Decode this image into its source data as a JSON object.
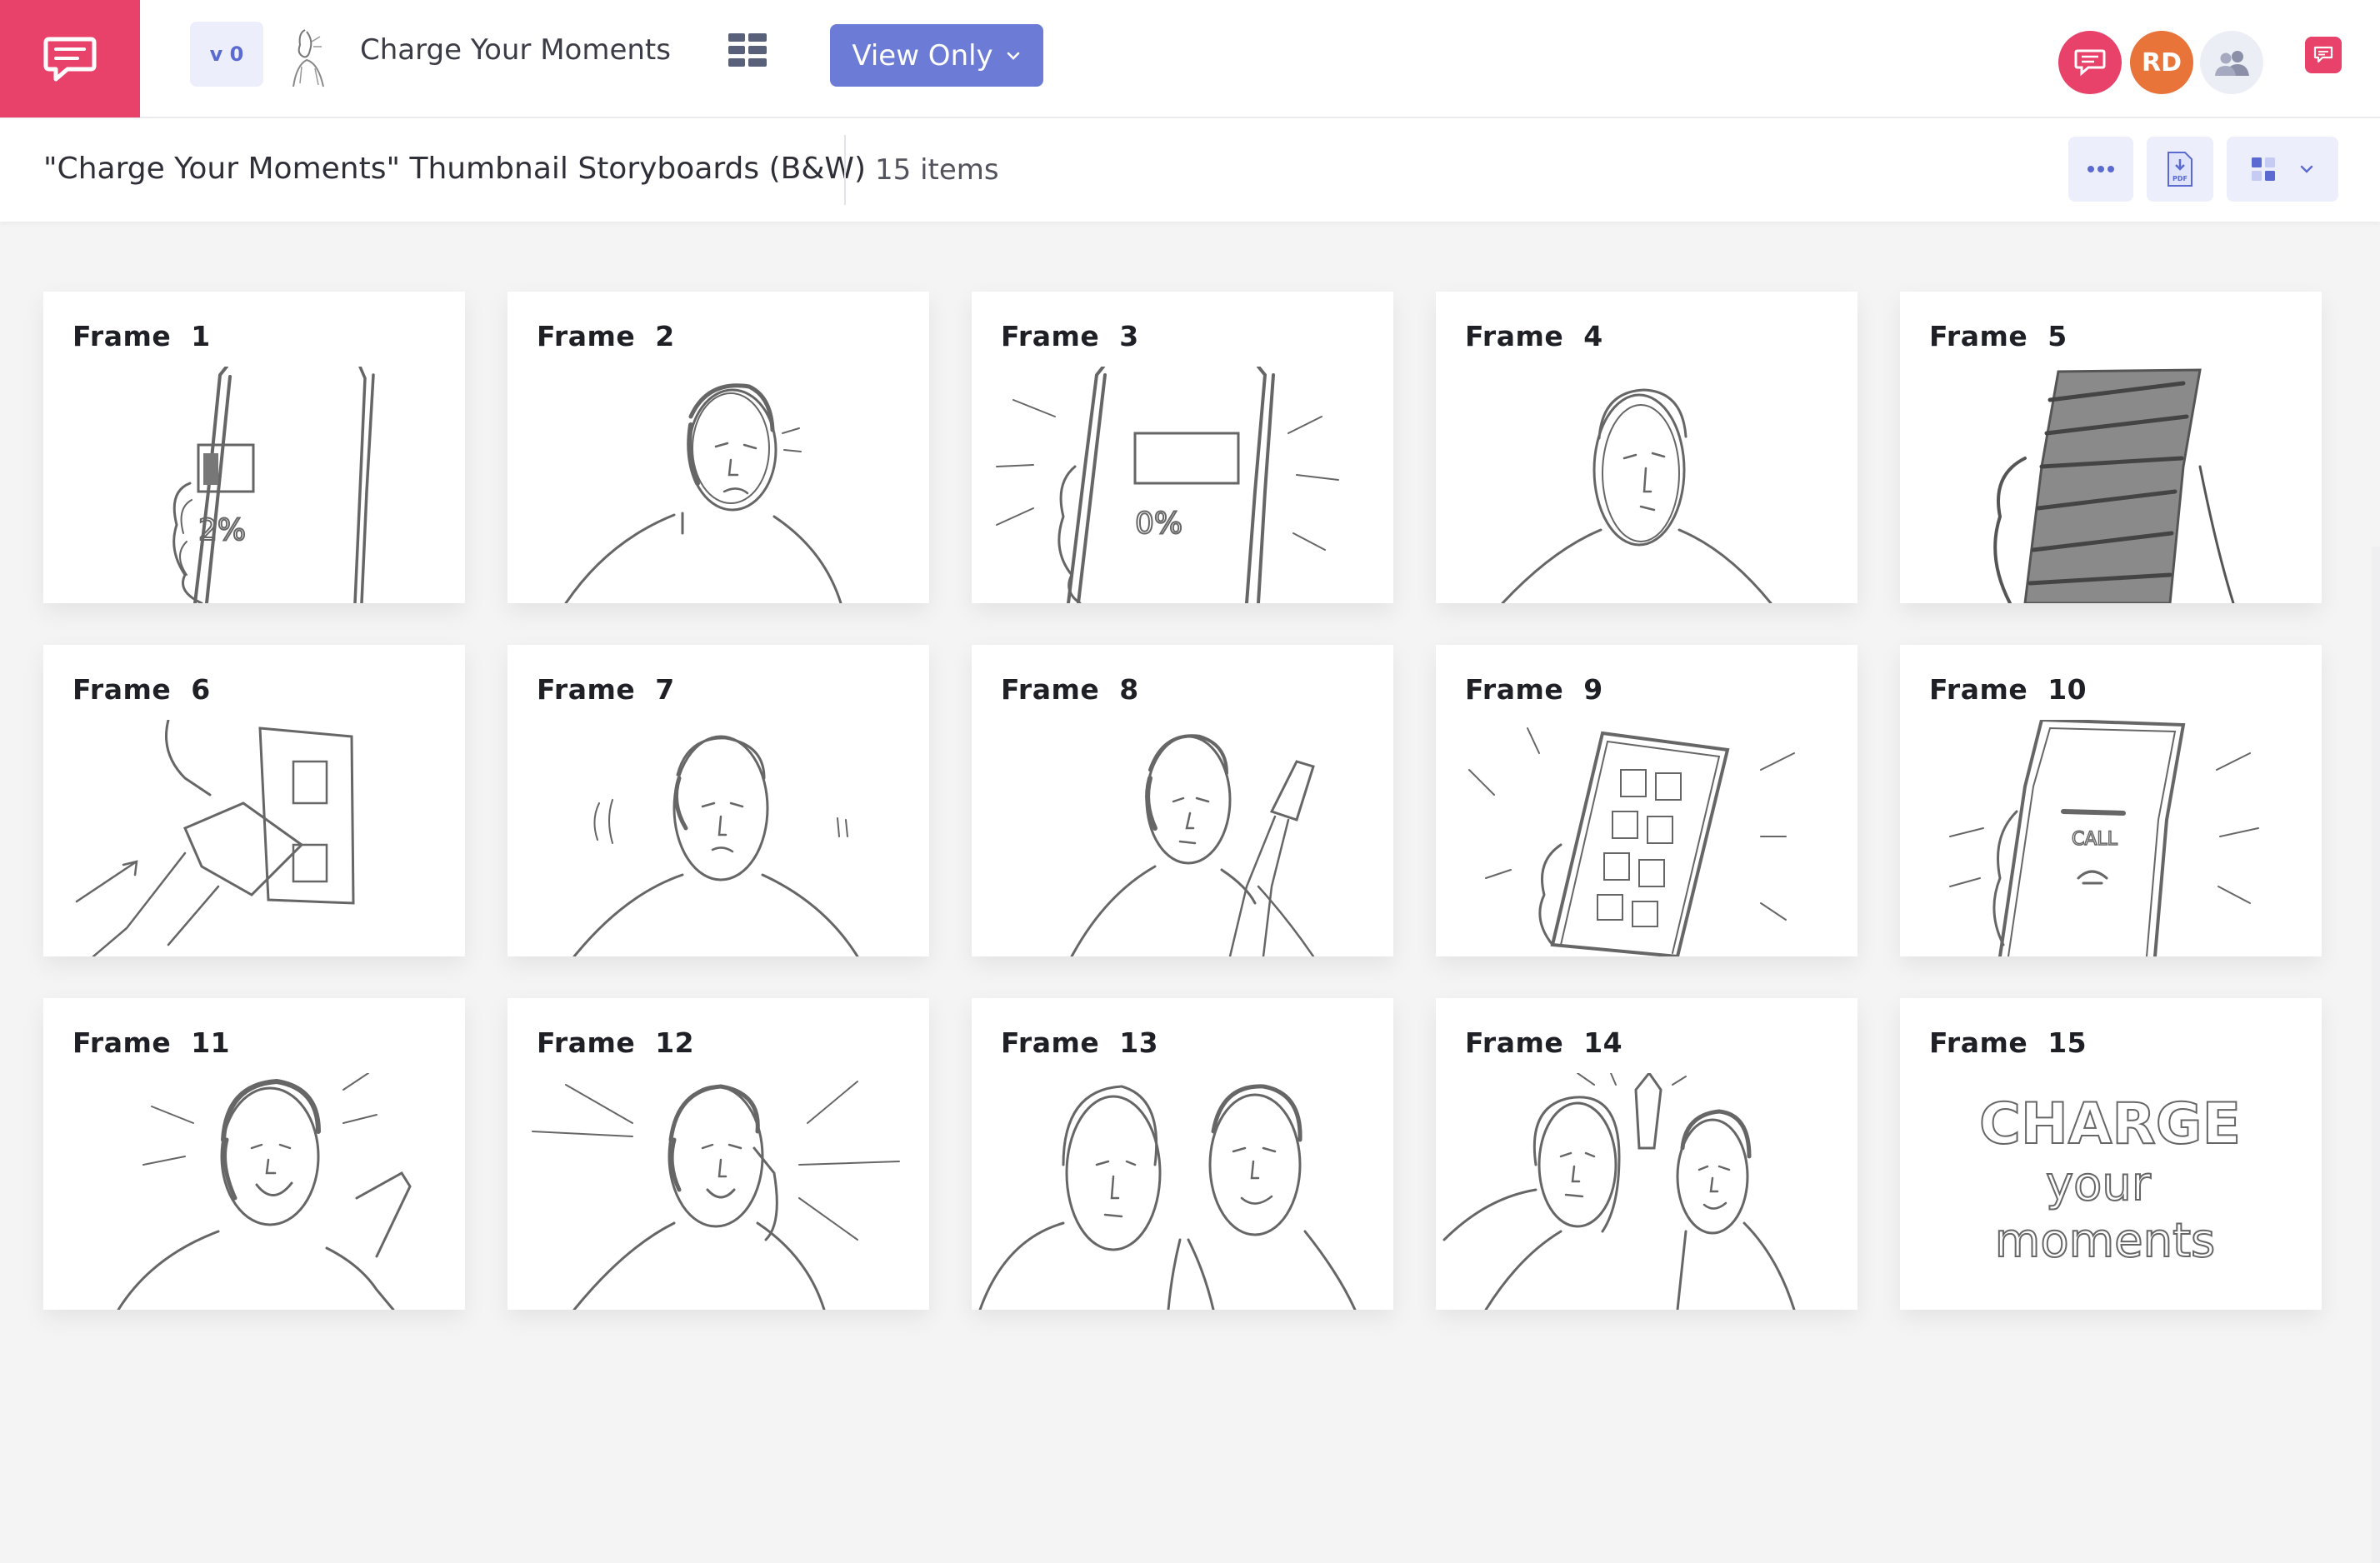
{
  "app": {
    "version_label": "v 0",
    "project_title": "Charge Your Moments",
    "view_mode_label": "View Only",
    "avatar_initials": "RD",
    "colors": {
      "brand": "#e8416a",
      "accent": "#6b7bd6",
      "avatar_rd": "#e8743a"
    }
  },
  "board": {
    "title": "\"Charge Your Moments\" Thumbnail Storyboards (B&W)",
    "item_count": "15 items"
  },
  "toolbar": {
    "pdf_badge": "PDF"
  },
  "frames": [
    {
      "label": "Frame  1",
      "sketch": "hand-phone-battery-2"
    },
    {
      "label": "Frame  2",
      "sketch": "worried-face"
    },
    {
      "label": "Frame  3",
      "sketch": "hand-phone-battery-0"
    },
    {
      "label": "Frame  4",
      "sketch": "surprised-face"
    },
    {
      "label": "Frame  5",
      "sketch": "dark-phone-screen"
    },
    {
      "label": "Frame  6",
      "sketch": "plug-in-charger"
    },
    {
      "label": "Frame  7",
      "sketch": "anxious-face"
    },
    {
      "label": "Frame  8",
      "sketch": "man-with-charging-phone"
    },
    {
      "label": "Frame  9",
      "sketch": "phone-home-screen"
    },
    {
      "label": "Frame  10",
      "sketch": "incoming-call-screen"
    },
    {
      "label": "Frame  11",
      "sketch": "happy-man-phone"
    },
    {
      "label": "Frame  12",
      "sketch": "man-on-call"
    },
    {
      "label": "Frame  13",
      "sketch": "two-friends-talking"
    },
    {
      "label": "Frame  14",
      "sketch": "high-five"
    },
    {
      "label": "Frame  15",
      "sketch": "charge-your-moments-title",
      "title_lines": [
        "CHARGE",
        "your",
        "moments"
      ]
    }
  ]
}
